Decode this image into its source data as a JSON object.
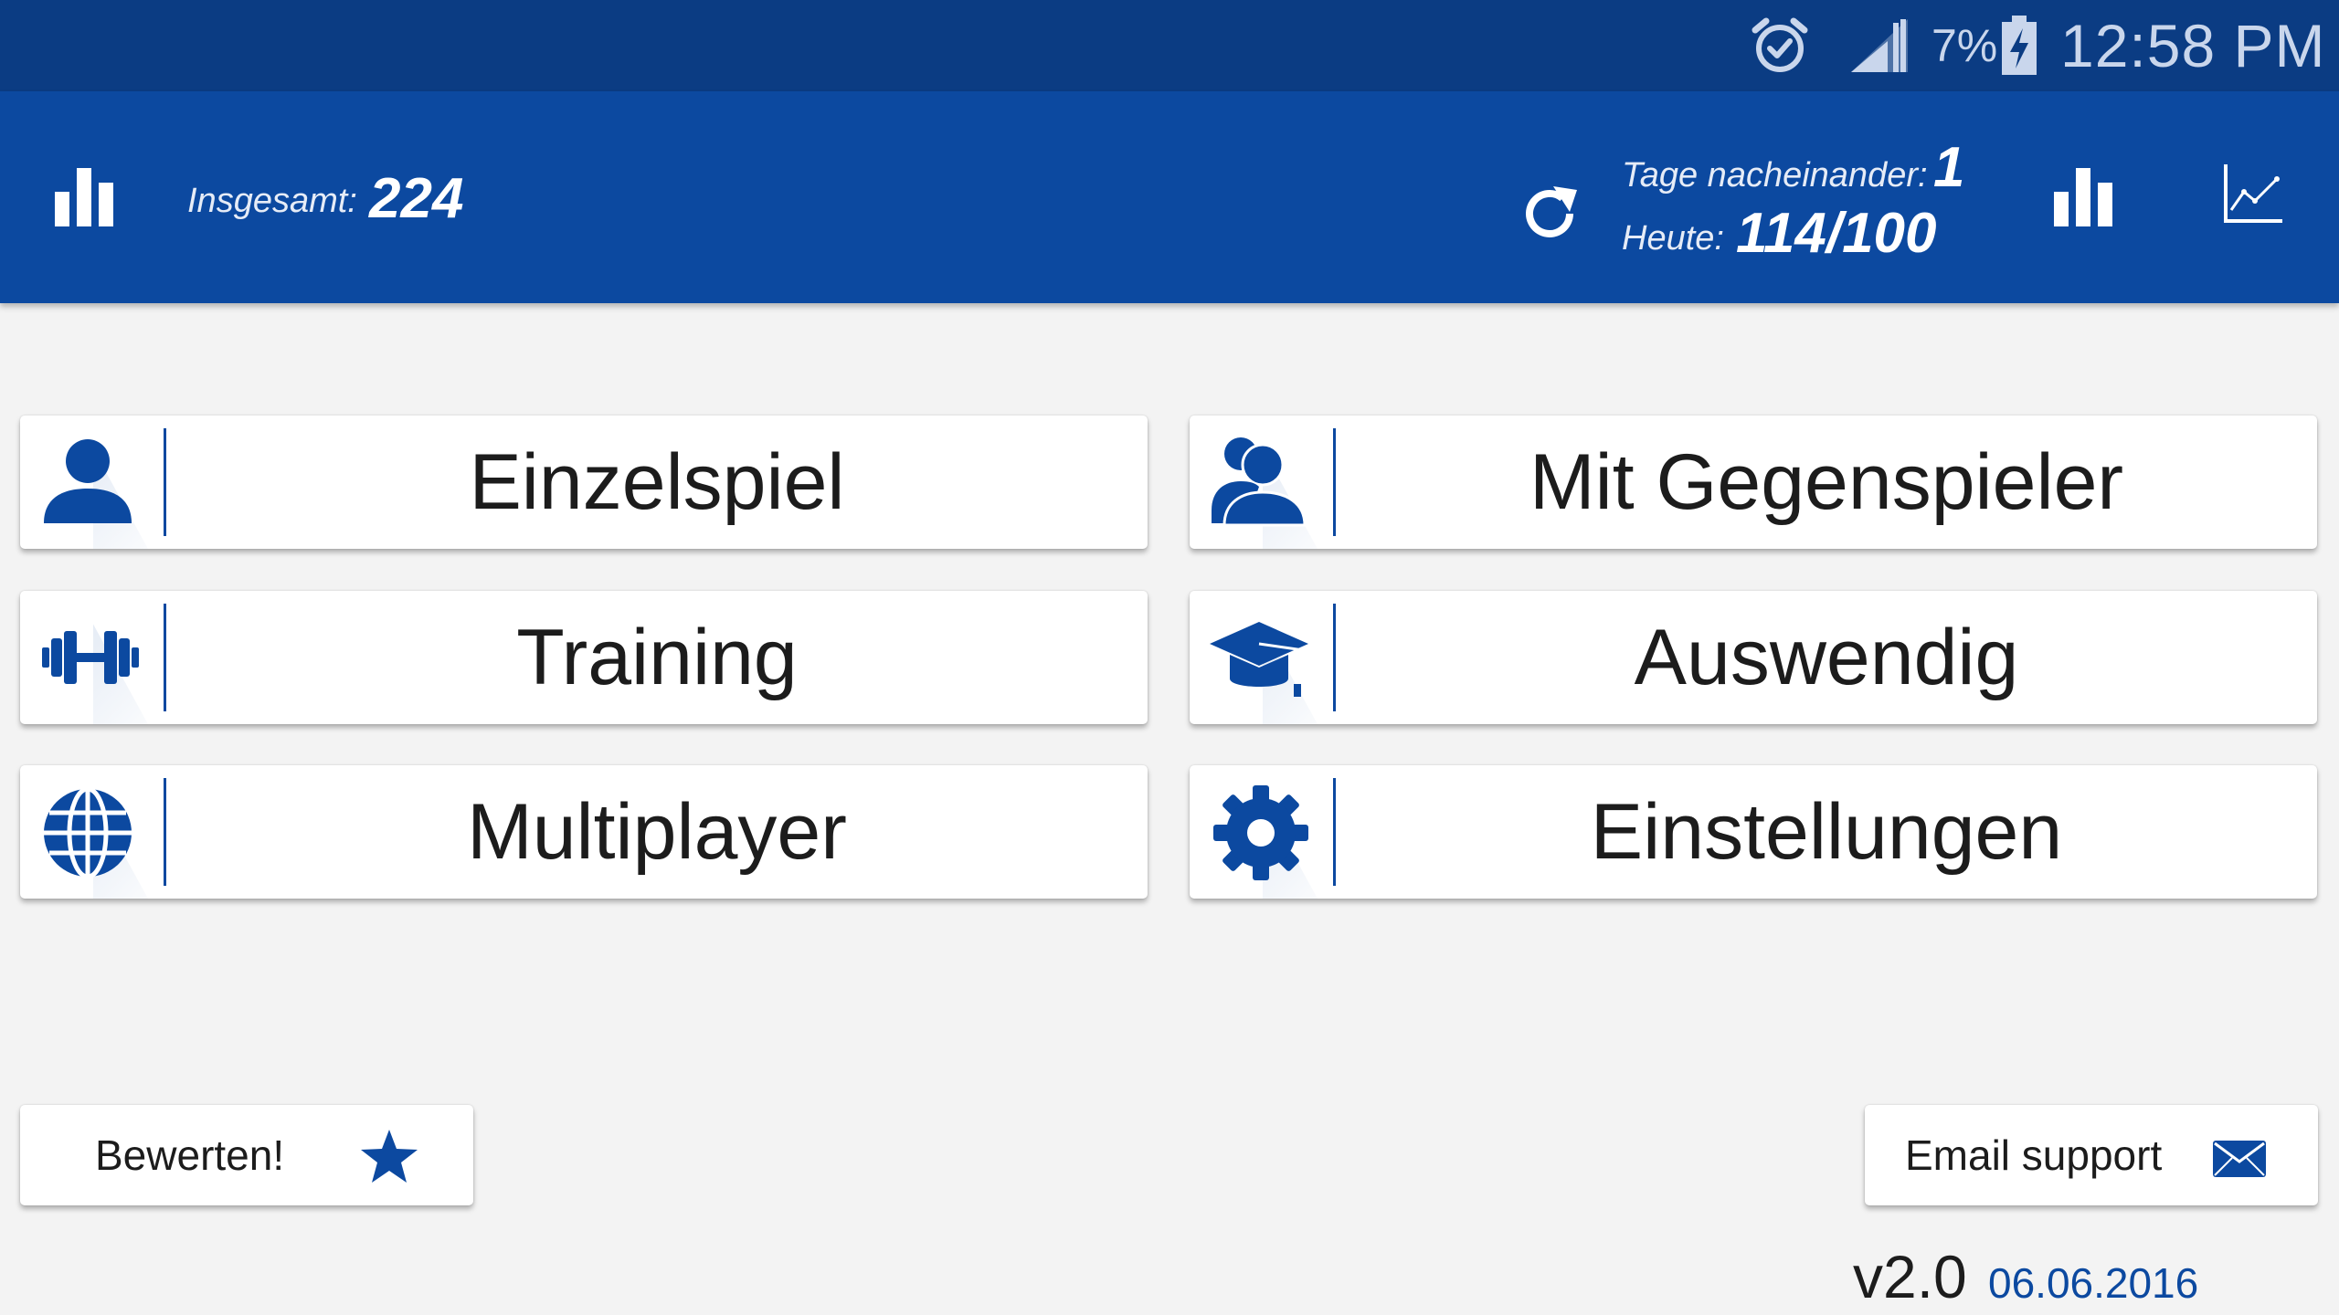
{
  "status_bar": {
    "battery_percent": "7%",
    "time": "12:58 PM",
    "icons": [
      "alarm-icon",
      "signal-icon",
      "battery-charging-icon"
    ]
  },
  "header": {
    "total_label": "Insgesamt:",
    "total_value": "224",
    "streak_label": "Tage nacheinander:",
    "streak_value": "1",
    "today_label": "Heute:",
    "today_value": "114/100",
    "icons": [
      "stats-icon",
      "refresh-icon",
      "stats-icon",
      "line-chart-icon"
    ]
  },
  "menu": {
    "items": [
      {
        "label": "Einzelspiel",
        "icon": "single-player-icon"
      },
      {
        "label": "Mit Gegenspieler",
        "icon": "opponent-icon"
      },
      {
        "label": "Training",
        "icon": "dumbbell-icon"
      },
      {
        "label": "Auswendig",
        "icon": "graduation-cap-icon"
      },
      {
        "label": "Multiplayer",
        "icon": "globe-icon"
      },
      {
        "label": "Einstellungen",
        "icon": "gear-icon"
      }
    ]
  },
  "footer": {
    "rate_label": "Bewerten!",
    "email_label": "Email support",
    "version": "v2.0",
    "version_date": "06.06.2016"
  },
  "colors": {
    "status_bar": "#0b3c83",
    "app_bar": "#0c49a0",
    "accent": "#0c49a0",
    "background": "#f3f3f3"
  }
}
